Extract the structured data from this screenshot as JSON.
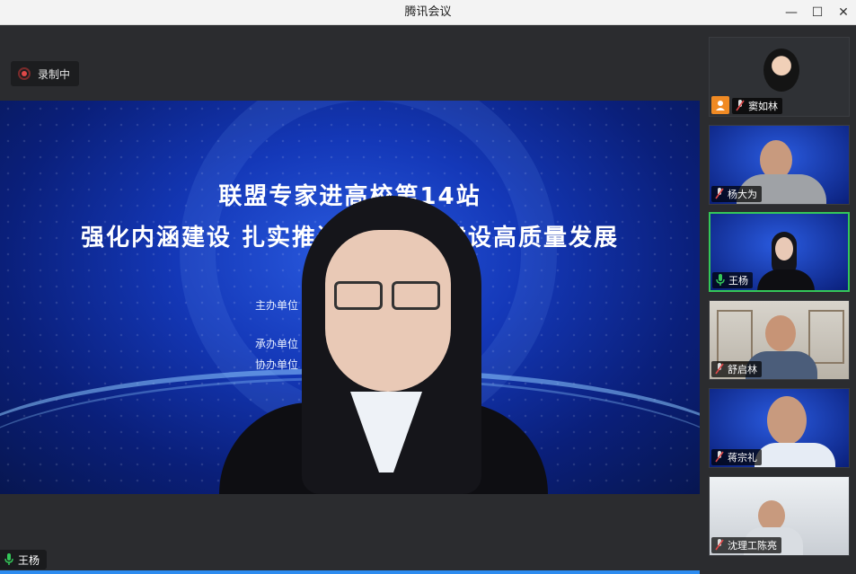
{
  "window": {
    "title": "腾讯会议",
    "minimize": "—",
    "maximize": "☐",
    "close": "✕"
  },
  "recording": {
    "label": "录制中"
  },
  "slide": {
    "line1": "联盟专家进高校第14站",
    "line2": "强化内涵建设  扎实推进职业教育建设高质量发展",
    "rows": [
      "主办单位",
      "承办单位",
      "协办单位"
    ]
  },
  "speaker": {
    "name": "王杨"
  },
  "participants": [
    {
      "name": "窦如林",
      "mic": "muted",
      "video": false,
      "active": false
    },
    {
      "name": "杨大为",
      "mic": "muted",
      "video": true,
      "active": false
    },
    {
      "name": "王杨",
      "mic": "on",
      "video": true,
      "active": true
    },
    {
      "name": "舒启林",
      "mic": "muted",
      "video": true,
      "active": false
    },
    {
      "name": "蒋宗礼",
      "mic": "muted",
      "video": true,
      "active": false
    },
    {
      "name": "沈理工陈亮",
      "mic": "muted",
      "video": true,
      "active": false
    }
  ],
  "colors": {
    "accent": "#2d8cf0",
    "active_border": "#34c759",
    "mic_on": "#34c759",
    "mic_muted": "#e04848"
  }
}
